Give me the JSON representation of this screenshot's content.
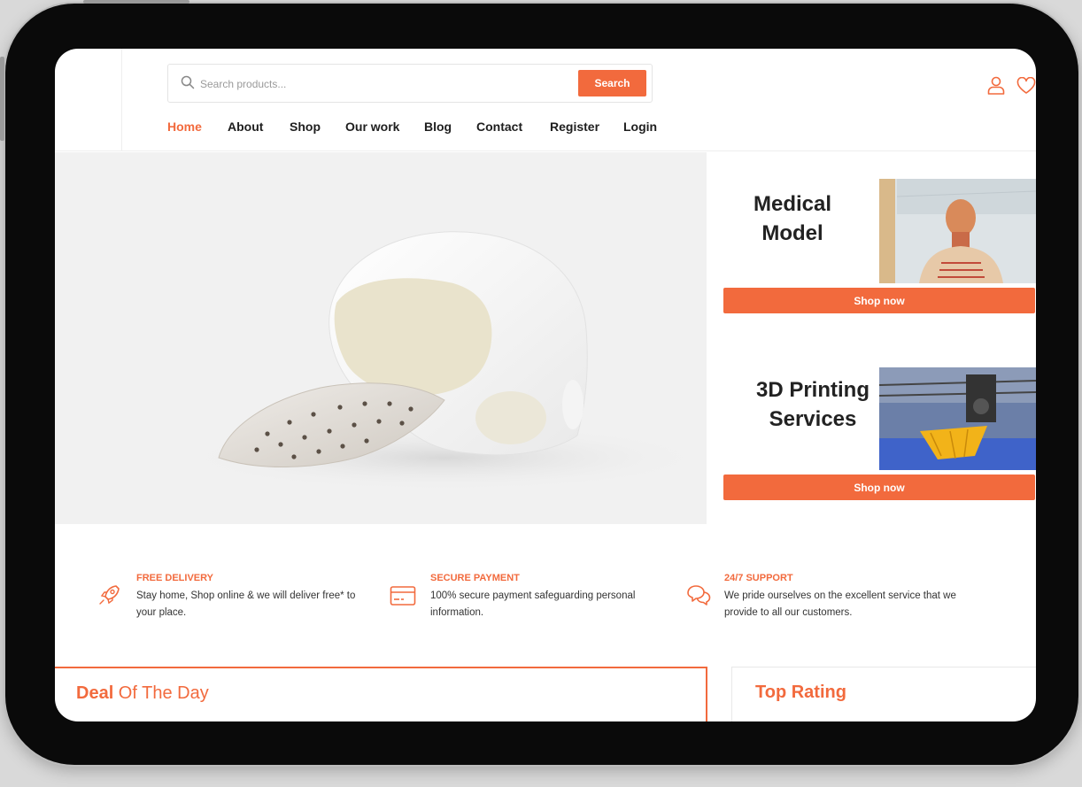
{
  "search": {
    "placeholder": "Search products...",
    "button_label": "Search"
  },
  "nav": {
    "items": [
      {
        "label": "Home",
        "active": true
      },
      {
        "label": "About"
      },
      {
        "label": "Shop"
      },
      {
        "label": "Our work"
      },
      {
        "label": "Blog"
      },
      {
        "label": "Contact"
      },
      {
        "label": "Register"
      },
      {
        "label": "Login"
      }
    ]
  },
  "header_icons": [
    "user-icon",
    "heart-icon"
  ],
  "promos": [
    {
      "title_line1": "Medical",
      "title_line2": "Model",
      "button_label": "Shop now"
    },
    {
      "title_line1": "3D Printing",
      "title_line2": "Services",
      "button_label": "Shop now"
    }
  ],
  "features": [
    {
      "icon": "rocket-icon",
      "title": "FREE DELIVERY",
      "desc_line1": "Stay home, Shop online & we will deliver free* to",
      "desc_line2": "your place."
    },
    {
      "icon": "credit-card-icon",
      "title": "SECURE PAYMENT",
      "desc_line1": "100% secure payment safeguarding personal",
      "desc_line2": "information."
    },
    {
      "icon": "chat-bubbles-icon",
      "title": "24/7 SUPPORT",
      "desc_line1": "We pride ourselves on the excellent service that we",
      "desc_line2": "provide to all our customers."
    }
  ],
  "sections": {
    "deal_bold": "Deal",
    "deal_rest": " Of The Day",
    "top_rating": "Top Rating"
  },
  "colors": {
    "accent": "#f26a3d",
    "text": "#1e1e1e",
    "hero_bg": "#f1f1f1",
    "frame": "#0a0a0a"
  }
}
